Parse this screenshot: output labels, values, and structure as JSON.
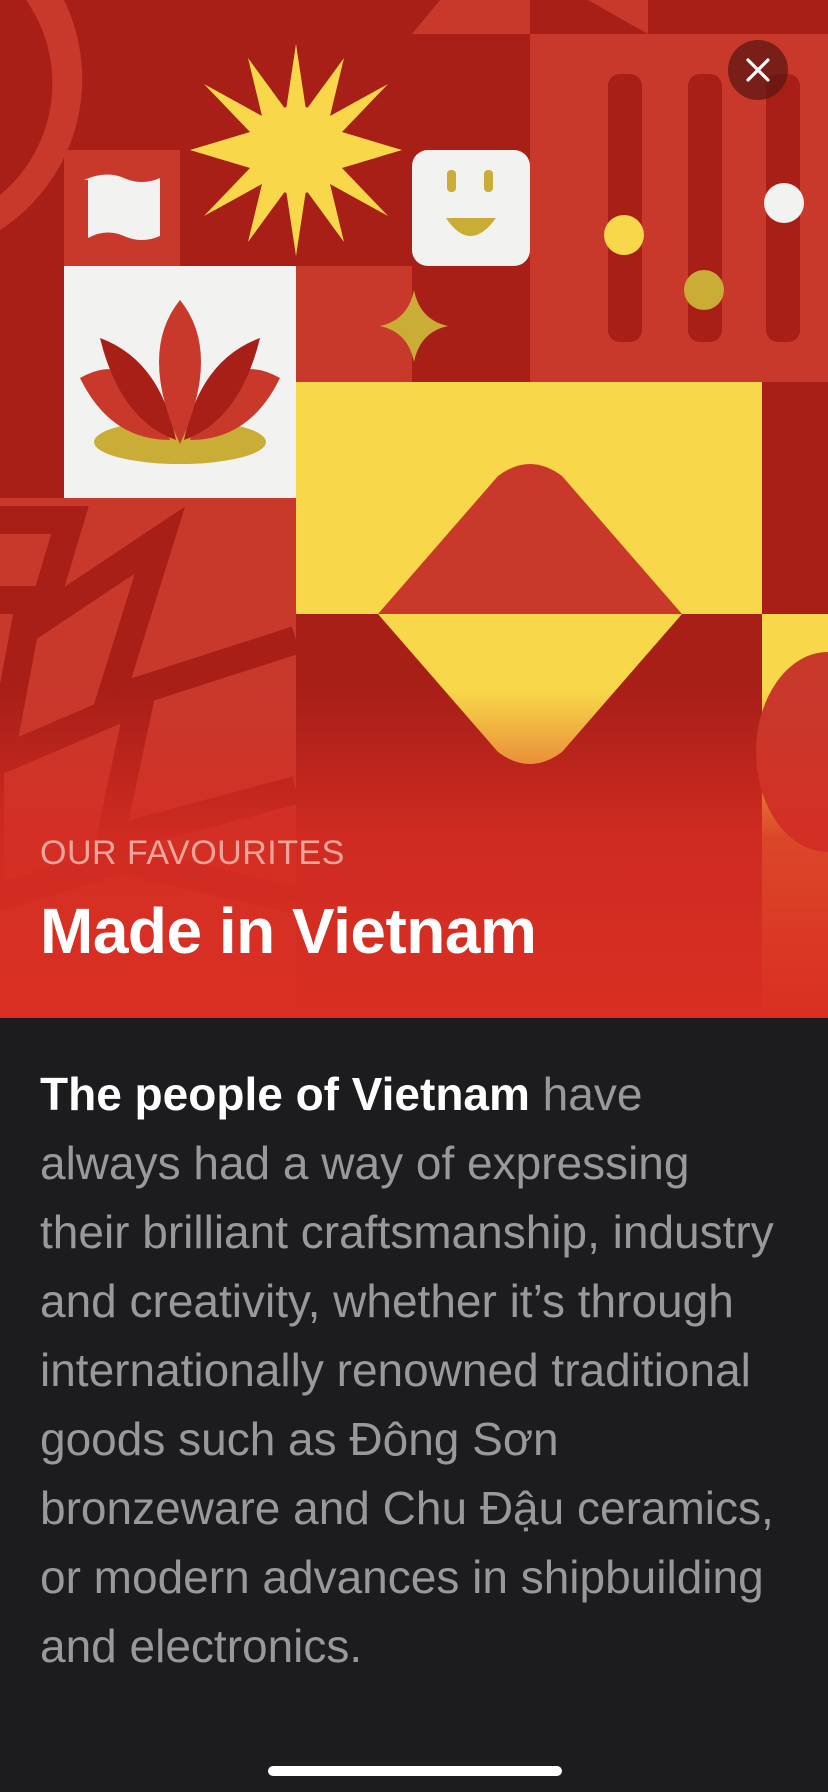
{
  "story": {
    "eyebrow": "OUR FAVOURITES",
    "title": "Made in Vietnam",
    "body_lead": "The people of Vietnam",
    "body_rest": " have always had a way of expressing their brilliant craftsmanship, industry and creativity, whether it’s through internationally renowned traditional goods such as Đông Sơn bronzeware and Chu Đậu ceramics, or modern advances in shipbuilding and electronics."
  },
  "icons": {
    "close": "close-icon",
    "sun": "sun-icon",
    "flag": "flag-icon",
    "smiley": "smiley-icon",
    "sparkle": "sparkle-icon",
    "lotus": "lotus-icon",
    "sliders": "slider-icon",
    "diamond": "diamond-icon",
    "star": "star-icon"
  },
  "colors": {
    "primary_red": "#c8392c",
    "deep_red": "#a81f18",
    "yellow": "#f8d84a",
    "mustard": "#c9ad36",
    "cream": "#f2f2f0",
    "eyebrow_pink": "#f4a49a",
    "background_dark": "#1c1c1e",
    "body_gray": "#98989d"
  }
}
